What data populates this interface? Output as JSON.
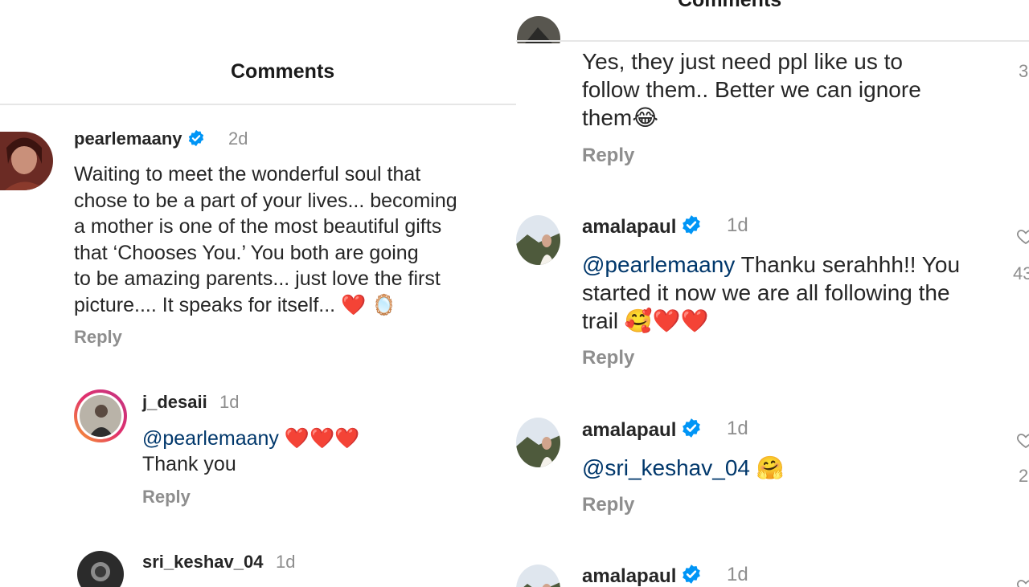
{
  "left": {
    "header_title": "Comments",
    "comments": [
      {
        "username": "pearlemaany",
        "verified": true,
        "time": "2d",
        "text_lines": [
          "Waiting to meet the wonderful soul that",
          "chose to be a part of your lives... becoming",
          "a mother is one of the most beautiful gifts",
          "that ‘Chooses You.’ You both are going",
          "to be amazing parents... just love the first",
          "picture.... It speaks for itself... ❤️ 🪞"
        ],
        "reply_label": "Reply"
      },
      {
        "username": "j_desaii",
        "verified": false,
        "time": "1d",
        "mention": "@pearlemaany",
        "mention_suffix": " ❤️❤️❤️",
        "text": "Thank you",
        "reply_label": "Reply"
      },
      {
        "username": "sri_keshav_04",
        "verified": false,
        "time": "1d"
      }
    ]
  },
  "right": {
    "header_title": "Comments",
    "comments": [
      {
        "text_lines": [
          "Yes, they just need ppl like us to",
          "follow them.. Better we can ignore",
          "them😂"
        ],
        "reply_label": "Reply",
        "edge_count": "3"
      },
      {
        "username": "amalapaul",
        "verified": true,
        "time": "1d",
        "mention": "@pearlemaany",
        "line1_suffix": " Thanku serahhh!! You",
        "line2": "started it now we are all following the",
        "line3": "trail 🥰❤️❤️",
        "reply_label": "Reply",
        "edge_count": "43"
      },
      {
        "username": "amalapaul",
        "verified": true,
        "time": "1d",
        "mention": "@sri_keshav_04",
        "mention_suffix": " 🤗",
        "reply_label": "Reply",
        "edge_count": "2"
      },
      {
        "username": "amalapaul",
        "verified": true,
        "time": "1d"
      }
    ]
  },
  "colors": {
    "text": "#262626",
    "muted": "#8e8e8e",
    "mention": "#00376b",
    "verified_badge": "#0095f6",
    "heart": "#ed1c24",
    "divider": "#e6e6e6"
  },
  "icons": [
    "verified-badge-icon",
    "heart-outline-icon"
  ]
}
